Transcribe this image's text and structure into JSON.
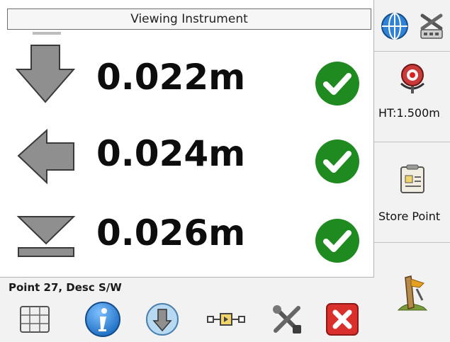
{
  "header": {
    "title": "Viewing Instrument"
  },
  "measurements": [
    {
      "value": "0.022m",
      "direction": "down-arrow-icon",
      "status": "ok"
    },
    {
      "value": "0.024m",
      "direction": "left-arrow-icon",
      "status": "ok"
    },
    {
      "value": "0.026m",
      "direction": "elevation-triangle-icon",
      "status": "ok"
    }
  ],
  "status": {
    "text": "Point 27, Desc S/W"
  },
  "side": {
    "height_label": "HT:1.500m",
    "store_label": "Store Point"
  },
  "colors": {
    "check_green": "#1f8a1f",
    "arrow_gray": "#8f8f8f",
    "close_red": "#d9302c",
    "info_blue": "#1f6fc4"
  }
}
